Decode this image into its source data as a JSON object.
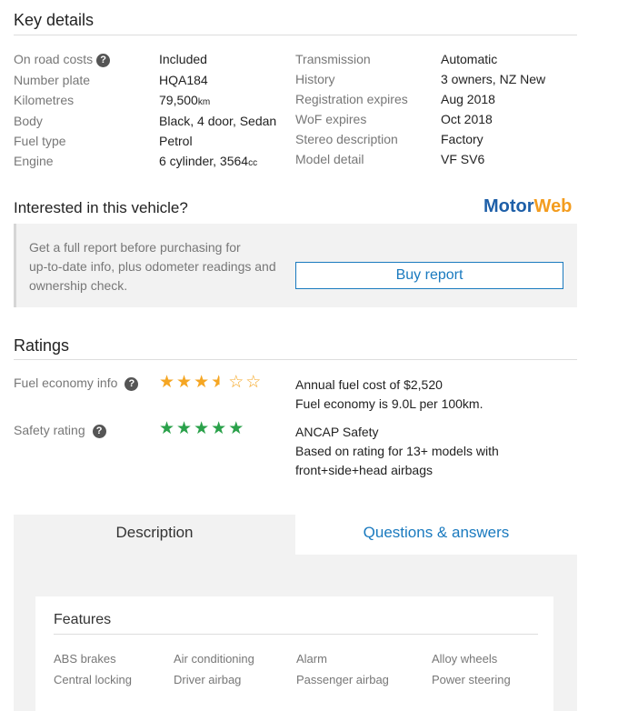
{
  "key_details": {
    "title": "Key details",
    "left": [
      {
        "label": "On road costs",
        "value": "Included",
        "help": true
      },
      {
        "label": "Number plate",
        "value": "HQA184"
      },
      {
        "label": "Kilometres",
        "value": "79,500",
        "unit": "km"
      },
      {
        "label": "Body",
        "value": "Black, 4 door, Sedan"
      },
      {
        "label": "Fuel type",
        "value": "Petrol"
      },
      {
        "label": "Engine",
        "value": "6 cylinder, 3564",
        "unit": "cc"
      }
    ],
    "right": [
      {
        "label": "Transmission",
        "value": "Automatic"
      },
      {
        "label": "History",
        "value": "3 owners, NZ New"
      },
      {
        "label": "Registration expires",
        "value": "Aug 2018"
      },
      {
        "label": "WoF expires",
        "value": "Oct 2018"
      },
      {
        "label": "Stereo description",
        "value": "Factory"
      },
      {
        "label": "Model detail",
        "value": "VF SV6"
      }
    ]
  },
  "interest": {
    "title": "Interested in this vehicle?",
    "brand_motor": "Motor",
    "brand_web": "Web",
    "text_lines": [
      "Get a full report before purchasing for",
      "up-to-date info, plus odometer readings and",
      "ownership check."
    ],
    "button": "Buy report"
  },
  "ratings": {
    "title": "Ratings",
    "fuel": {
      "label": "Fuel economy info",
      "stars": 3.5,
      "max": 5,
      "color": "#f5a623",
      "lines": [
        "Annual fuel cost of $2,520",
        "Fuel economy is 9.0L per 100km."
      ]
    },
    "safety": {
      "label": "Safety rating",
      "stars": 5,
      "max": 5,
      "color": "#2aa14a",
      "lines": [
        "ANCAP Safety",
        "Based on rating for 13+ models with",
        "front+side+head airbags"
      ]
    }
  },
  "tabs": {
    "description": "Description",
    "qa": "Questions & answers"
  },
  "features": {
    "title": "Features",
    "items": [
      "ABS brakes",
      "Air conditioning",
      "Alarm",
      "Alloy wheels",
      "Central locking",
      "Driver airbag",
      "Passenger airbag",
      "Power steering"
    ]
  },
  "colors": {
    "accent": "#1a7abf",
    "motorweb_blue": "#1e5fa8",
    "motorweb_orange": "#f39c1e"
  }
}
